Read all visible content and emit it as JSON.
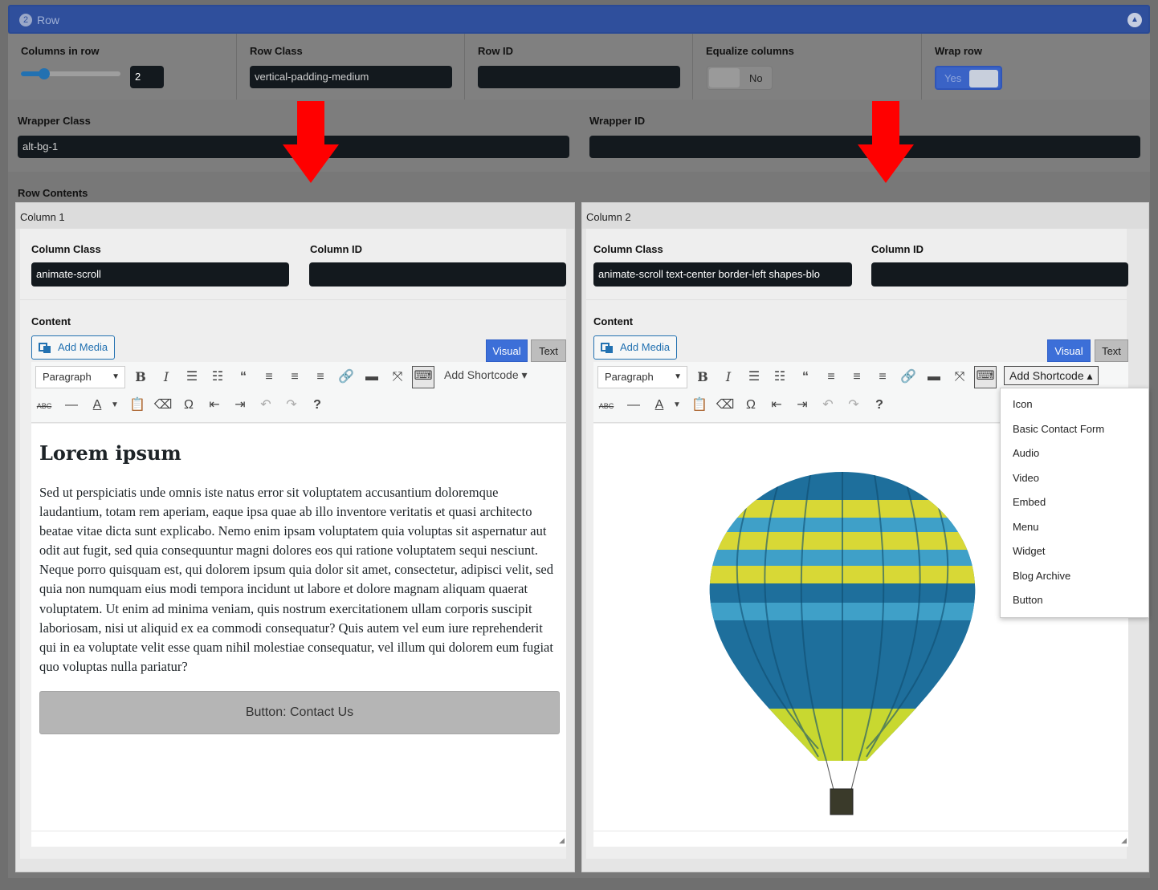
{
  "header": {
    "num": "2",
    "title": "Row",
    "collapse_icon": "chevron-up-icon"
  },
  "row": {
    "columns_label": "Columns in row",
    "columns_value": "2",
    "slider_fraction": 0.24,
    "row_class_label": "Row Class",
    "row_class_value": "vertical-padding-medium",
    "row_id_label": "Row ID",
    "row_id_value": "",
    "equalize_label": "Equalize columns",
    "equalize_value": "No",
    "wrap_label": "Wrap row",
    "wrap_value": "Yes"
  },
  "wrapper": {
    "class_label": "Wrapper Class",
    "class_value": "alt-bg-1",
    "id_label": "Wrapper ID",
    "id_value": ""
  },
  "row_contents_label": "Row Contents",
  "col1": {
    "title": "Column 1",
    "class_label": "Column Class",
    "class_value": "animate-scroll",
    "id_label": "Column ID",
    "id_value": "",
    "content_label": "Content",
    "add_media": "Add Media",
    "visual": "Visual",
    "text": "Text",
    "format": "Paragraph",
    "shortcode": "Add Shortcode ▾",
    "heading": "Lorem ipsum",
    "body": "Sed ut perspiciatis unde omnis iste natus error sit voluptatem accusantium doloremque laudantium, totam rem aperiam, eaque ipsa quae ab illo inventore veritatis et quasi architecto beatae vitae dicta sunt explicabo. Nemo enim ipsam voluptatem quia voluptas sit aspernatur aut odit aut fugit, sed quia consequuntur magni dolores eos qui ratione voluptatem sequi nesciunt. Neque porro quisquam est, qui dolorem ipsum quia dolor sit amet, consectetur, adipisci velit, sed quia non numquam eius modi tempora incidunt ut labore et dolore magnam aliquam quaerat voluptatem. Ut enim ad minima veniam, quis nostrum exercitationem ullam corporis suscipit laboriosam, nisi ut aliquid ex ea commodi consequatur? Quis autem vel eum iure reprehenderit qui in ea voluptate velit esse quam nihil molestiae consequatur, vel illum qui dolorem eum fugiat quo voluptas nulla pariatur?",
    "button": "Button: Contact Us"
  },
  "col2": {
    "title": "Column 2",
    "class_label": "Column Class",
    "class_value": "animate-scroll text-center border-left shapes-blo",
    "id_label": "Column ID",
    "id_value": "",
    "content_label": "Content",
    "add_media": "Add Media",
    "visual": "Visual",
    "text": "Text",
    "format": "Paragraph",
    "shortcode": "Add Shortcode ▴"
  },
  "dropdown": [
    "Icon",
    "Basic Contact Form",
    "Audio",
    "Video",
    "Embed",
    "Menu",
    "Widget",
    "Blog Archive",
    "Button"
  ],
  "colors": {
    "header": "#2f4f9c",
    "visual_tab": "#3c6fd8",
    "arrow": "#ff0000",
    "balloon_blue": "#1d6f9a",
    "balloon_yellow": "#d8d836"
  }
}
